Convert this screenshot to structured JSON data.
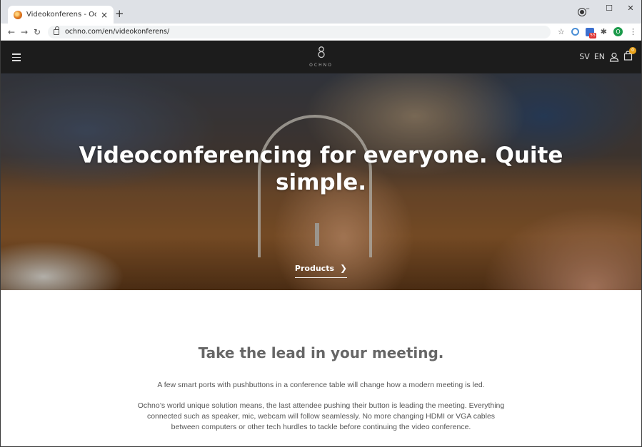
{
  "browser": {
    "tab_title": "Videokonferens - Ochno",
    "tab_close": "×",
    "new_tab": "+",
    "url": "ochno.com/en/videokonferens/",
    "ext_badge": "55",
    "avatar_letter": "O",
    "window_buttons": [
      "–",
      "☐",
      "✕"
    ]
  },
  "header": {
    "logo_text": "OCHNO",
    "lang_sv": "SV",
    "lang_en": "EN",
    "cart_count": "0"
  },
  "hero": {
    "title": "Videoconferencing for everyone. Quite simple.",
    "cta_label": "Products",
    "cta_chevron": "❯"
  },
  "content": {
    "heading": "Take the lead in your meeting.",
    "paragraph1": "A few smart ports with pushbuttons in a conference table will change how a modern meeting is led.",
    "paragraph2": "Ochno’s world unique solution means, the last attendee pushing their button is leading the meeting. Everything connected such as speaker, mic, webcam will follow seamlessly. No more changing HDMI or VGA cables between computers or other tech hurdles to tackle before continuing the video conference."
  }
}
